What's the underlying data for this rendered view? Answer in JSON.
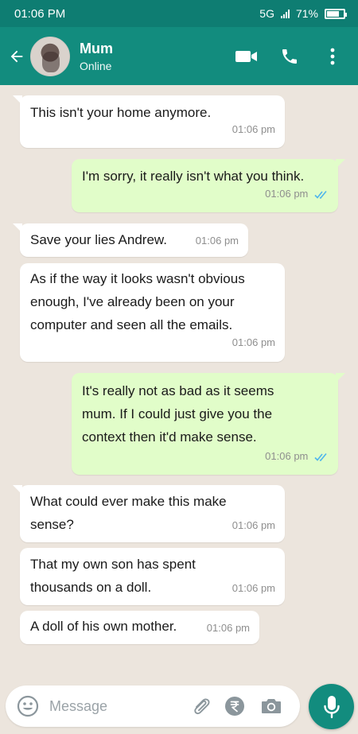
{
  "status_bar": {
    "time": "01:06 PM",
    "network": "5G",
    "battery": "71%"
  },
  "header": {
    "name": "Mum",
    "status": "Online"
  },
  "messages": [
    {
      "dir": "in",
      "lines": [
        "This isn't your home anymore."
      ],
      "time": "01:06 pm"
    },
    {
      "dir": "out",
      "lines": [
        "I'm sorry, it really isn't what you think."
      ],
      "time": "01:06 pm"
    },
    {
      "dir": "in",
      "lines": [
        "Save your lies Andrew."
      ],
      "time": "01:06 pm"
    },
    {
      "dir": "in",
      "lines": [
        "As if the way it looks wasn't obvious",
        "enough, I've already been on your",
        "computer and seen all the emails."
      ],
      "time": "01:06 pm"
    },
    {
      "dir": "out",
      "lines": [
        "It's really not as bad as it seems",
        "mum. If I could just give you the",
        "context then it'd make sense."
      ],
      "time": "01:06 pm"
    },
    {
      "dir": "in",
      "lines": [
        "What could ever make this make",
        "sense?"
      ],
      "time": "01:06 pm"
    },
    {
      "dir": "in",
      "lines": [
        "That my own son has spent",
        "thousands on a doll."
      ],
      "time": "01:06 pm"
    },
    {
      "dir": "in",
      "lines": [
        "A doll of his own mother."
      ],
      "time": "01:06 pm"
    }
  ],
  "composer": {
    "placeholder": "Message"
  },
  "colors": {
    "header": "#128c7e",
    "status_bar": "#0e7d72",
    "incoming": "#ffffff",
    "outgoing": "#e1fdc9",
    "ticks": "#4fb6ec"
  },
  "icons": [
    "back-arrow-icon",
    "video-call-icon",
    "phone-icon",
    "more-options-icon",
    "emoji-icon",
    "attach-icon",
    "rupee-icon",
    "camera-icon",
    "mic-icon",
    "double-tick-icon"
  ]
}
